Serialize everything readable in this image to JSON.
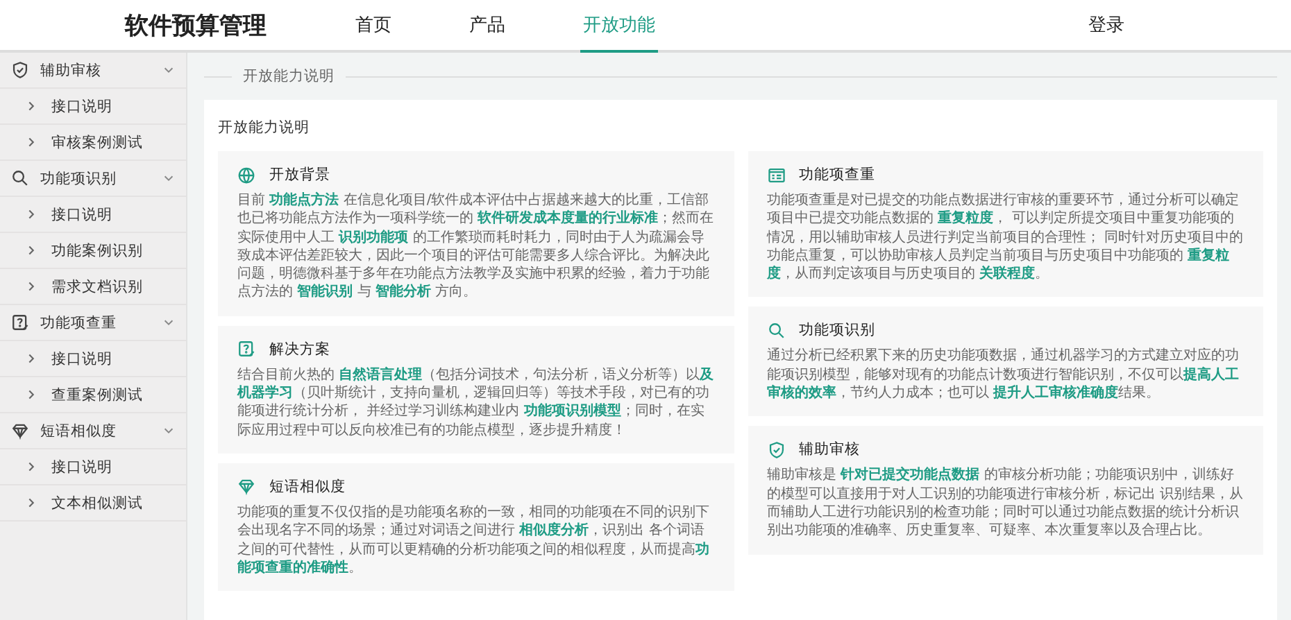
{
  "header": {
    "logo": "软件预算管理",
    "nav": [
      {
        "label": "首页",
        "selected": false
      },
      {
        "label": "产品",
        "selected": false
      },
      {
        "label": "开放功能",
        "selected": true
      }
    ],
    "login": "登录"
  },
  "sidebar": {
    "groups": [
      {
        "label": "辅助审核",
        "expanded": true,
        "items": [
          "接口说明",
          "审核案例测试"
        ]
      },
      {
        "label": "功能项识别",
        "expanded": true,
        "items": [
          "接口说明",
          "功能案例识别",
          "需求文档识别"
        ]
      },
      {
        "label": "功能项查重",
        "expanded": true,
        "items": [
          "接口说明",
          "查重案例测试"
        ]
      },
      {
        "label": "短语相似度",
        "expanded": true,
        "items": [
          "接口说明",
          "文本相似测试"
        ]
      }
    ]
  },
  "section_title": "开放能力说明",
  "panel": {
    "title": "开放能力说明",
    "columns": [
      [
        {
          "title": "开放背景",
          "text": "目前 **功能点方法** 在信息化项目/软件成本评估中占据越来越大的比重，工信部也已将功能点方法作为一项科学统一的 **软件研发成本度量的行业标准**；然而在实际使用中人工 **识别功能项** 的工作繁琐而耗时耗力，同时由于人为疏漏会导致成本评估差距较大，因此一个项目的评估可能需要多人综合评比。为解决此问题，明德微科基于多年在功能点方法教学及实施中积累的经验，着力于功能点方法的 **智能识别** 与 **智能分析** 方向。"
        },
        {
          "title": "解决方案",
          "text": "结合目前火热的 **自然语言处理**（包括分词技术，句法分析，语义分析等）以**及机器学习**（贝叶斯统计，支持向量机，逻辑回归等）等技术手段，对已有的功能项进行统计分析， 并经过学习训练构建业内 **功能项识别模型**；同时，在实际应用过程中可以反向校准已有的功能点模型，逐步提升精度！"
        },
        {
          "title": "短语相似度",
          "text": "功能项的重复不仅仅指的是功能项名称的一致，相同的功能项在不同的识别下会出现名字不同的场景；通过对词语之间进行 **相似度分析**，识别出 各个词语之间的可代替性，从而可以更精确的分析功能项之间的相似程度，从而提高**功能项查重的准确性**。"
        }
      ],
      [
        {
          "title": "功能项查重",
          "text": "功能项查重是对已提交的功能点数据进行审核的重要环节，通过分析可以确定项目中已提交功能点数据的 **重复粒度**， 可以判定所提交项目中重复功能项的情况，用以辅助审核人员进行判定当前项目的合理性； 同时针对历史项目中的功能点重复，可以协助审核人员判定当前项目与历史项目中功能项的 **重复粒度**，从而判定该项目与历史项目的 **关联程度**。"
        },
        {
          "title": "功能项识别",
          "text": "通过分析已经积累下来的历史功能项数据，通过机器学习的方式建立对应的功能项识别模型，能够对现有的功能点计数项进行智能识别，不仅可以**提高人工审核的效率**，节约人力成本；也可以 **提升人工审核准确度**结果。"
        },
        {
          "title": "辅助审核",
          "text": "辅助审核是 **针对已提交功能点数据** 的审核分析功能；功能项识别中，训练好的模型可以直接用于对人工识别的功能项进行审核分析，标记出 识别结果，从而辅助人工进行功能识别的检查功能；同时可以通过功能点数据的统计分析识别出功能项的准确率、历史重复率、可疑率、本次重复率以及合理占比。"
        }
      ]
    ]
  }
}
